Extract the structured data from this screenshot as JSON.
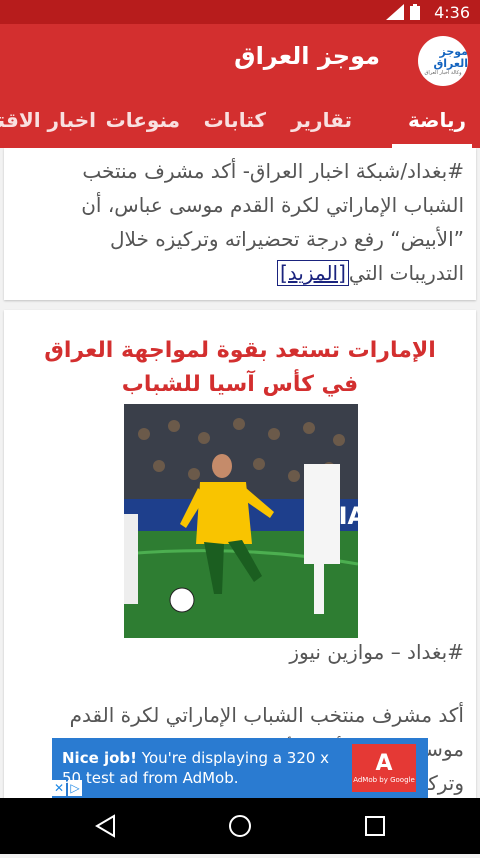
{
  "status_bar": {
    "time": "4:36",
    "network": "4G"
  },
  "app_bar": {
    "title": "موجز العراق",
    "logo_text": "موجز العراق",
    "logo_subtitle": "وكالة اخبار العراق"
  },
  "tabs": [
    "رياضة",
    "تقارير",
    "كتابات",
    "منوعات",
    "اخبار الاقتصاد"
  ],
  "card1": {
    "lines": [
      "#بغداد/شبكة اخبار العراق- أكد مشرف منتخب",
      "الشباب الإماراتي لكرة القدم موسى عباس، أن",
      "”الأبيض“ رفع درجة تحضيراته وتركيزه خلال",
      "التدريبات التي"
    ],
    "more_link": "[المزيد]"
  },
  "card2": {
    "headline": "الإمارات تستعد بقوة لمواجهة العراق في كأس آسيا للشباب",
    "byline": "#بغداد – موازين نيوز",
    "body": "أكد مشرف منتخب الشباب الإماراتي لكرة القدم موسى عباس، أن ”الأبيض“ رفع درجة تحضيراته وتركيزه",
    "photo_sign": "KIA"
  },
  "ad": {
    "bold": "Nice job!",
    "text": " You're displaying a 320 x 50 test ad from AdMob.",
    "icon_glyph": "A",
    "caption": "AdMob by Google"
  },
  "colors": {
    "primary": "#d32f2f",
    "status": "#b71c1c",
    "headline": "#d32f2f",
    "ad": "#2a7bd1"
  }
}
